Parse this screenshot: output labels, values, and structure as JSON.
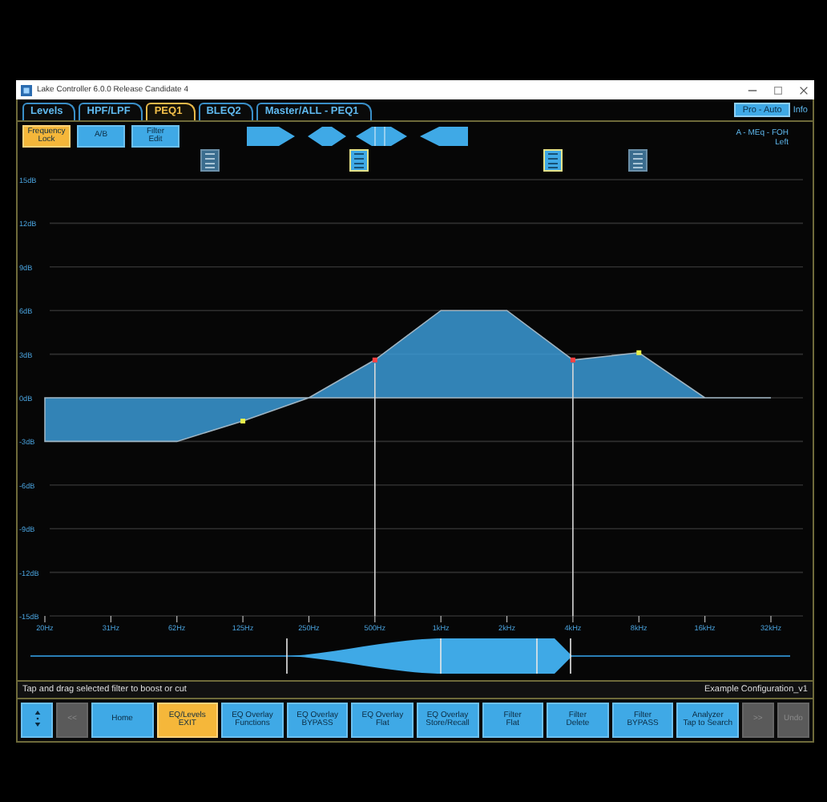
{
  "window": {
    "title": "Lake Controller 6.0.0 Release Candidate 4"
  },
  "tabs": [
    {
      "label": "Levels",
      "selected": false
    },
    {
      "label": "HPF/LPF",
      "selected": false
    },
    {
      "label": "PEQ1",
      "selected": true
    },
    {
      "label": "BLEQ2",
      "selected": false
    },
    {
      "label": "Master/ALL - PEQ1",
      "selected": false
    }
  ],
  "top_right": {
    "mode_button": "Pro - Auto",
    "info_link": "Info",
    "channel_lines": [
      "A - MEq - FOH",
      "Left"
    ]
  },
  "toolbar": [
    {
      "lines": [
        "Frequency",
        "Lock"
      ],
      "selected": true
    },
    {
      "lines": [
        "A/B"
      ],
      "selected": false
    },
    {
      "lines": [
        "Filter",
        "Edit"
      ],
      "selected": false
    }
  ],
  "filter_markers": [
    {
      "selected": false
    },
    {
      "selected": true
    },
    {
      "selected": true
    },
    {
      "selected": false
    }
  ],
  "eq_chart": {
    "chart_data": {
      "type": "area",
      "ylim": [
        -15,
        15
      ],
      "grid": true,
      "ref_lines": [
        {
          "axis": "x",
          "value": "500Hz"
        },
        {
          "axis": "x",
          "value": "4kHz"
        }
      ],
      "categories": [
        "20Hz",
        "31Hz",
        "62Hz",
        "125Hz",
        "250Hz",
        "500Hz",
        "1kHz",
        "2kHz",
        "4kHz",
        "8kHz",
        "16kHz",
        "32kHz"
      ],
      "series": [
        {
          "color": "#3b9ad6",
          "values": [
            -3,
            -3,
            -3,
            -1.6,
            0,
            2.6,
            6,
            6,
            2.6,
            3.1,
            0,
            0
          ]
        }
      ],
      "yticks": [
        {
          "value": 15,
          "label": "15dB"
        },
        {
          "value": 12,
          "label": "12dB"
        },
        {
          "value": 9,
          "label": "9dB"
        },
        {
          "value": 6,
          "label": "6dB"
        },
        {
          "value": 3,
          "label": "3dB"
        },
        {
          "value": 0,
          "label": "0dB"
        },
        {
          "value": -3,
          "label": "-3dB"
        },
        {
          "value": -6,
          "label": "-6dB"
        },
        {
          "value": -9,
          "label": "-9dB"
        },
        {
          "value": -12,
          "label": "-12dB"
        },
        {
          "value": -15,
          "label": "-15dB"
        }
      ]
    },
    "handles": [
      {
        "selected": false
      },
      {
        "selected": true
      },
      {
        "selected": true
      },
      {
        "selected": false
      }
    ]
  },
  "status_bar": {
    "hint": "Tap and drag selected filter to boost or cut",
    "configuration": "Example Configuration_v1"
  },
  "function_buttons": [
    {
      "kind": "scroll",
      "selected": false,
      "disabled": false
    },
    {
      "kind": "nav",
      "lines": [
        "<<"
      ],
      "selected": false,
      "disabled": true
    },
    {
      "kind": "key",
      "lines": [
        "Home"
      ],
      "selected": false,
      "disabled": false
    },
    {
      "kind": "key",
      "lines": [
        "EQ/Levels",
        "EXIT"
      ],
      "selected": true,
      "disabled": false
    },
    {
      "kind": "key",
      "lines": [
        "EQ Overlay",
        "Functions"
      ],
      "selected": false,
      "disabled": false
    },
    {
      "kind": "key",
      "lines": [
        "EQ Overlay",
        "BYPASS"
      ],
      "selected": false,
      "disabled": false
    },
    {
      "kind": "key",
      "lines": [
        "EQ Overlay",
        "Flat"
      ],
      "selected": false,
      "disabled": false
    },
    {
      "kind": "key",
      "lines": [
        "EQ Overlay",
        "Store/Recall"
      ],
      "selected": false,
      "disabled": false
    },
    {
      "kind": "key",
      "lines": [
        "Filter",
        "Flat"
      ],
      "selected": false,
      "disabled": false
    },
    {
      "kind": "key",
      "lines": [
        "Filter",
        "Delete"
      ],
      "selected": false,
      "disabled": false
    },
    {
      "kind": "key",
      "lines": [
        "Filter",
        "BYPASS"
      ],
      "selected": false,
      "disabled": false
    },
    {
      "kind": "key",
      "lines": [
        "Analyzer",
        "Tap to Search"
      ],
      "selected": false,
      "disabled": false
    },
    {
      "kind": "nav",
      "lines": [
        ">>"
      ],
      "selected": false,
      "disabled": true
    },
    {
      "kind": "nav",
      "lines": [
        "Undo"
      ],
      "selected": false,
      "disabled": true
    }
  ]
}
